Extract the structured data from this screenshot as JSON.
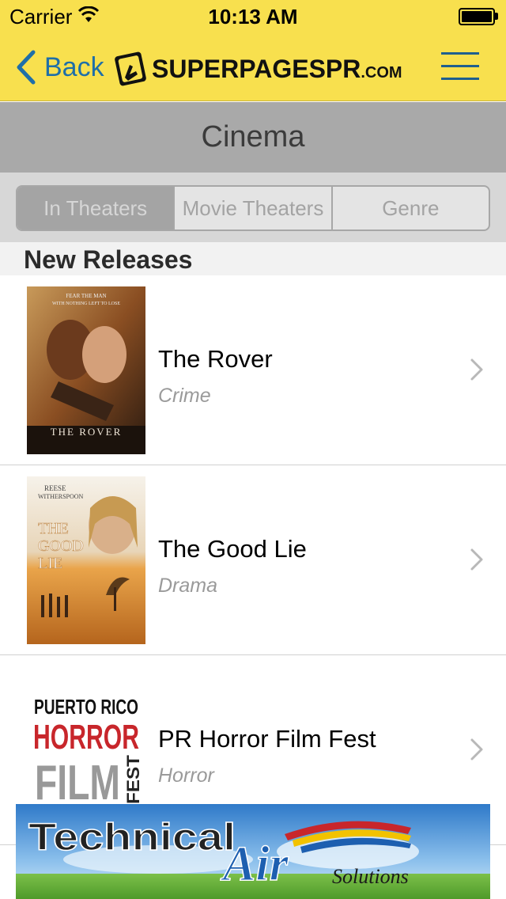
{
  "status_bar": {
    "carrier": "Carrier",
    "time": "10:13 AM"
  },
  "nav": {
    "back_label": "Back",
    "logo": "SuperPagesPR.com"
  },
  "header": {
    "title": "Cinema"
  },
  "segments": [
    {
      "label": "In Theaters",
      "active": true
    },
    {
      "label": "Movie Theaters",
      "active": false
    },
    {
      "label": "Genre",
      "active": false
    }
  ],
  "list_section": {
    "title": "New Releases"
  },
  "movies": [
    {
      "title": "The Rover",
      "genre": "Crime",
      "poster_text": [
        "FEAR THE MAN",
        "WITH NOTHING LEFT TO LOSE",
        "THE ROVER"
      ]
    },
    {
      "title": "The Good Lie",
      "genre": "Drama",
      "poster_text": [
        "REESE",
        "WITHERSPOON",
        "THE",
        "GOOD",
        "LIE"
      ]
    },
    {
      "title": "PR Horror Film Fest",
      "genre": "Horror",
      "poster_text": [
        "PUERTO RICO",
        "HORROR",
        "FILM",
        "FEST"
      ]
    }
  ],
  "ad": {
    "text": "Technical",
    "script_text": "Air",
    "sub_text": "Solutions"
  },
  "colors": {
    "brand_yellow": "#f8e04e",
    "link_blue": "#1f6fa8",
    "header_gray": "#a9a9a9"
  }
}
